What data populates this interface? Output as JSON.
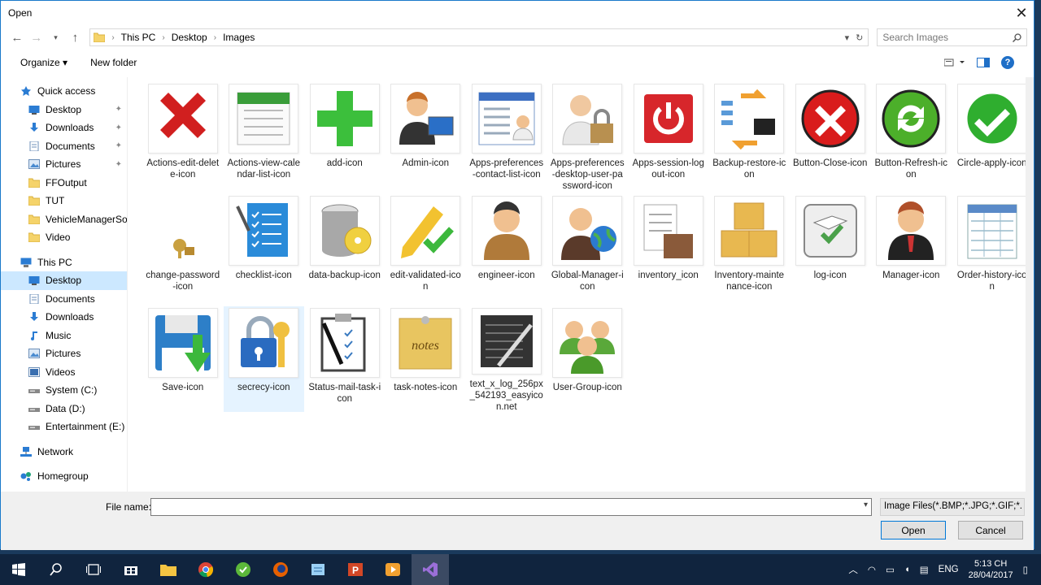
{
  "window": {
    "title": "Open"
  },
  "address": {
    "crumbs": [
      "This PC",
      "Desktop",
      "Images"
    ],
    "search_placeholder": "Search Images"
  },
  "toolbar": {
    "organize": "Organize ▾",
    "new_folder": "New folder"
  },
  "nav": {
    "items": [
      {
        "label": "Quick access",
        "level": "top",
        "icon": "star-icon",
        "pinned": false
      },
      {
        "label": "Desktop",
        "level": "l1",
        "icon": "desktop-icon",
        "pinned": true
      },
      {
        "label": "Downloads",
        "level": "l1",
        "icon": "downloads-icon",
        "pinned": true
      },
      {
        "label": "Documents",
        "level": "l1",
        "icon": "documents-icon",
        "pinned": true
      },
      {
        "label": "Pictures",
        "level": "l1",
        "icon": "pictures-icon",
        "pinned": true
      },
      {
        "label": "FFOutput",
        "level": "l1",
        "icon": "folder-icon",
        "pinned": false
      },
      {
        "label": "TUT",
        "level": "l1",
        "icon": "folder-icon",
        "pinned": false
      },
      {
        "label": "VehicleManagerSoft",
        "level": "l1",
        "icon": "folder-icon",
        "pinned": false
      },
      {
        "label": "Video",
        "level": "l1",
        "icon": "folder-icon",
        "pinned": false
      },
      {
        "label": "This PC",
        "level": "top",
        "icon": "pc-icon",
        "pinned": false
      },
      {
        "label": "Desktop",
        "level": "l1",
        "icon": "desktop-icon",
        "pinned": false,
        "selected": true
      },
      {
        "label": "Documents",
        "level": "l1",
        "icon": "documents-icon",
        "pinned": false
      },
      {
        "label": "Downloads",
        "level": "l1",
        "icon": "downloads-icon",
        "pinned": false
      },
      {
        "label": "Music",
        "level": "l1",
        "icon": "music-icon",
        "pinned": false
      },
      {
        "label": "Pictures",
        "level": "l1",
        "icon": "pictures-icon",
        "pinned": false
      },
      {
        "label": "Videos",
        "level": "l1",
        "icon": "videos-icon",
        "pinned": false
      },
      {
        "label": "System (C:)",
        "level": "l1",
        "icon": "drive-icon",
        "pinned": false
      },
      {
        "label": "Data (D:)",
        "level": "l1",
        "icon": "drive-icon",
        "pinned": false
      },
      {
        "label": "Entertainment (E:)",
        "level": "l1",
        "icon": "drive-icon",
        "pinned": false
      },
      {
        "label": "Network",
        "level": "top",
        "icon": "network-icon",
        "pinned": false
      },
      {
        "label": "Homegroup",
        "level": "top",
        "icon": "homegroup-icon",
        "pinned": false
      }
    ]
  },
  "files": [
    {
      "name": "Actions-edit-delete-icon",
      "icon": "red-x",
      "color": "#d11f1f"
    },
    {
      "name": "Actions-view-calendar-list-icon",
      "icon": "calendar",
      "color": "#3a9d3a"
    },
    {
      "name": "add-icon",
      "icon": "plus",
      "color": "#3cbf3c"
    },
    {
      "name": "Admin-icon",
      "icon": "person-monitor",
      "color": "#c8702a"
    },
    {
      "name": "Apps-preferences-contact-list-icon",
      "icon": "contact-list",
      "color": "#3c6fc2"
    },
    {
      "name": "Apps-preferences-desktop-user-password-icon",
      "icon": "user-lock",
      "color": "#b89050"
    },
    {
      "name": "Apps-session-logout-icon",
      "icon": "power",
      "color": "#d7262b"
    },
    {
      "name": "Backup-restore-icon",
      "icon": "backup",
      "color": "#f0a030"
    },
    {
      "name": "Button-Close-icon",
      "icon": "close-circle",
      "color": "#d91c1c"
    },
    {
      "name": "Button-Refresh-icon",
      "icon": "refresh-circle",
      "color": "#4caf2a"
    },
    {
      "name": "Circle-apply-icon",
      "icon": "check-circle",
      "color": "#2fae2f"
    },
    {
      "name": "change-password-icon",
      "icon": "small-key",
      "color": "#c9a040"
    },
    {
      "name": "checklist-icon",
      "icon": "checklist",
      "color": "#2a8bd9"
    },
    {
      "name": "data-backup-icon",
      "icon": "database",
      "color": "#a8a8a8"
    },
    {
      "name": "edit-validated-icon",
      "icon": "pencil-check",
      "color": "#f2c230"
    },
    {
      "name": "engineer-icon",
      "icon": "person",
      "color": "#b07a3a"
    },
    {
      "name": "Global-Manager-icon",
      "icon": "person-globe",
      "color": "#2b7ad0"
    },
    {
      "name": "inventory_icon",
      "icon": "inventory",
      "color": "#8a5a3a"
    },
    {
      "name": "Inventory-maintenance-icon",
      "icon": "boxes",
      "color": "#e8b850"
    },
    {
      "name": "log-icon",
      "icon": "log",
      "color": "#4aa04a"
    },
    {
      "name": "Manager-icon",
      "icon": "person-red",
      "color": "#b0502a"
    },
    {
      "name": "Order-history-icon",
      "icon": "sheet",
      "color": "#5a8ac8"
    },
    {
      "name": "Save-icon",
      "icon": "floppy",
      "color": "#2d7fc8"
    },
    {
      "name": "secrecy-icon",
      "icon": "padlock",
      "color": "#2a6bc0",
      "selected": true
    },
    {
      "name": "Status-mail-task-icon",
      "icon": "clipboard",
      "color": "#444444"
    },
    {
      "name": "task-notes-icon",
      "icon": "notes",
      "color": "#e8c560"
    },
    {
      "name": "text_x_log_256px_542193_easyicon.net",
      "icon": "notebook",
      "color": "#333333"
    },
    {
      "name": "User-Group-icon",
      "icon": "group",
      "color": "#5aa83a"
    }
  ],
  "footer": {
    "file_name_label": "File name:",
    "file_name_value": "",
    "filter": "Image Files(*.BMP;*.JPG;*.GIF;*.",
    "open": "Open",
    "cancel": "Cancel"
  },
  "taskbar": {
    "time": "5:13 CH",
    "date": "28/04/2017",
    "lang": "ENG"
  }
}
